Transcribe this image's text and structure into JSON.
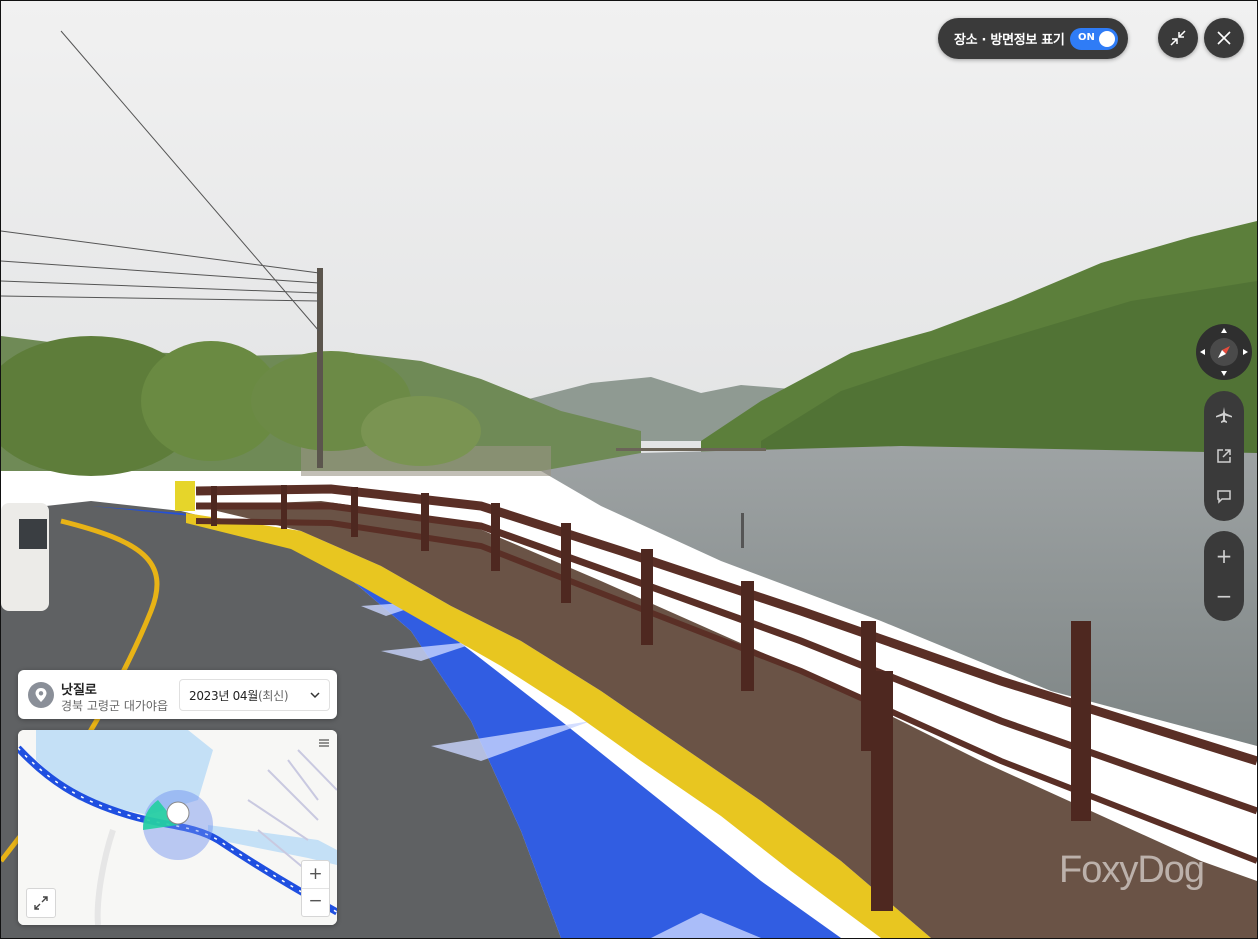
{
  "header": {
    "info_toggle_label": "장소 · 방면정보 표기",
    "info_toggle_state": "ON"
  },
  "icons": {
    "collapse": "collapse-icon",
    "close": "close-icon",
    "compass": "compass-icon",
    "airplane": "airplane-icon",
    "share": "share-icon",
    "report": "report-icon",
    "zoom_in": "plus-icon",
    "zoom_out": "minus-icon",
    "pin": "location-pin-icon",
    "chevron": "chevron-down-icon",
    "expand": "expand-icon",
    "layers": "layers-icon"
  },
  "location": {
    "road_name": "낫질로",
    "address": "경북 고령군 대가야읍",
    "date_value": "2023년 04월",
    "date_suffix": "(최신)"
  },
  "zoom": {
    "in_label": "+",
    "out_label": "−"
  },
  "minimap": {
    "zoom_in_label": "+",
    "zoom_out_label": "−"
  },
  "watermark": "FoxyDog",
  "colors": {
    "accent_blue": "#2f7cf6",
    "route_blue": "#1f4fe0",
    "control_dark": "#3a3a3a",
    "compass_red": "#e84c3d"
  }
}
